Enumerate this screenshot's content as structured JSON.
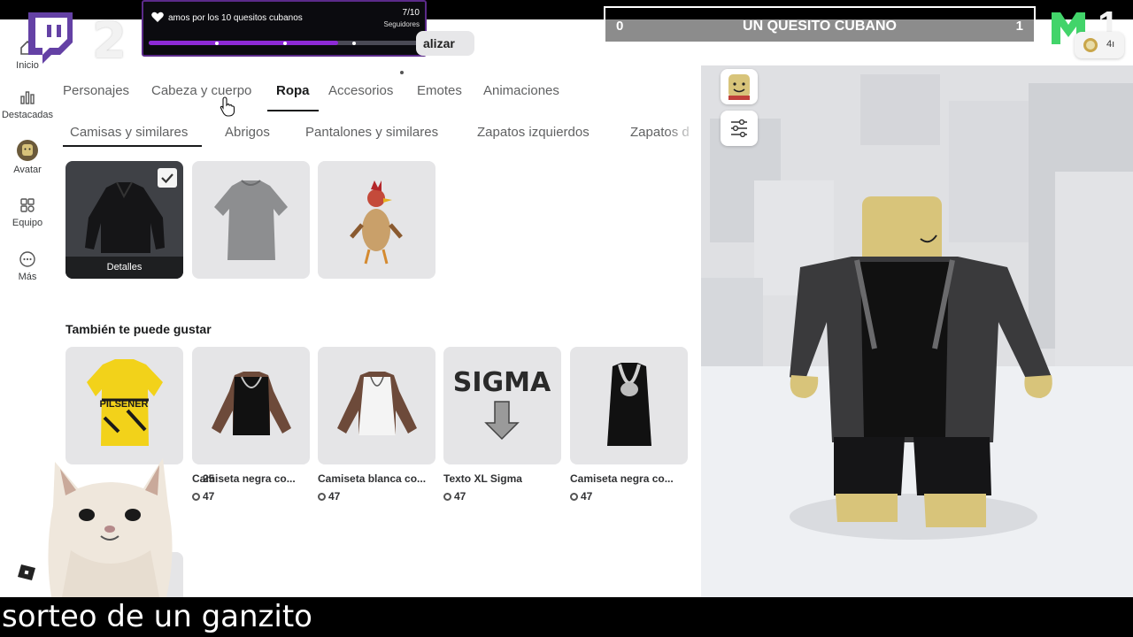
{
  "overlay": {
    "left_score_big": "2",
    "right_score_big": "1",
    "goal": {
      "text": "amos por los 10 quesitos cubanos",
      "count": "7/10",
      "label": "Seguidores",
      "progress": 0.7
    },
    "scoreboard": {
      "left": "0",
      "title": "UN QUESITO CUBANO",
      "right": "1"
    },
    "robux": "4ı"
  },
  "nav": {
    "items": [
      {
        "label": "Inicio",
        "icon": "home-icon"
      },
      {
        "label": "Destacadas",
        "icon": "chart-icon"
      },
      {
        "label": "Avatar",
        "icon": "avatar-icon"
      },
      {
        "label": "Equipo",
        "icon": "team-icon"
      },
      {
        "label": "Más",
        "icon": "more-icon"
      }
    ]
  },
  "header": {
    "update_button": "alizar"
  },
  "tabs": [
    "Personajes",
    "Cabeza y cuerpo",
    "Ropa",
    "Accesorios",
    "Emotes",
    "Animaciones"
  ],
  "active_tab": "Ropa",
  "subtabs": [
    "Camisas y similares",
    "Abrigos",
    "Pantalones y similares",
    "Zapatos izquierdos",
    "Zapatos d"
  ],
  "active_subtab": "Camisas y similares",
  "owned": {
    "detail_label": "Detalles",
    "items": [
      {
        "name": "black-jacket",
        "selected": true
      },
      {
        "name": "gray-tshirt",
        "selected": false
      },
      {
        "name": "rooster",
        "selected": false
      }
    ]
  },
  "recommend": {
    "title": "También te puede gustar",
    "items": [
      {
        "name": "25",
        "price": ""
      },
      {
        "name": "Camiseta negra co...",
        "price": "47"
      },
      {
        "name": "Camiseta blanca co...",
        "price": "47"
      },
      {
        "name": "Texto XL Sigma",
        "price": "47"
      },
      {
        "name": "Camiseta negra co...",
        "price": "47"
      }
    ],
    "sigma_text": "SIGMA",
    "jersey_text": "PILSENER"
  },
  "subtitle": "sorteo de un ganzito",
  "colors": {
    "accent_purple": "#8d2ad6",
    "text_dark": "#1a1b1c",
    "text_muted": "#606162"
  }
}
